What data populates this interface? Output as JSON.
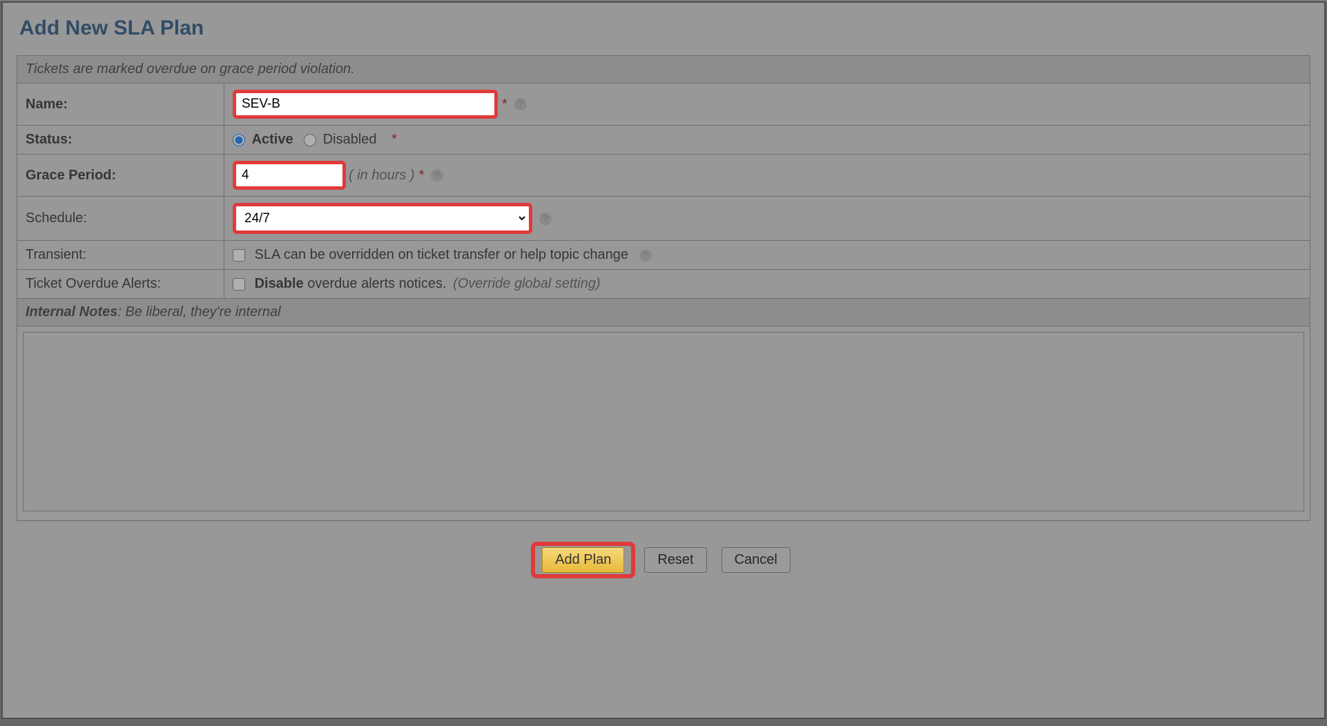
{
  "page": {
    "title": "Add New SLA Plan"
  },
  "form": {
    "header_note": "Tickets are marked overdue on grace period violation.",
    "name": {
      "label": "Name:",
      "value": "SEV-B"
    },
    "status": {
      "label": "Status:",
      "active_label": "Active",
      "disabled_label": "Disabled"
    },
    "grace_period": {
      "label": "Grace Period:",
      "value": "4",
      "hint": "( in hours )"
    },
    "schedule": {
      "label": "Schedule:",
      "value": "24/7"
    },
    "transient": {
      "label": "Transient:",
      "text": "SLA can be overridden on ticket transfer or help topic change"
    },
    "overdue_alerts": {
      "label": "Ticket Overdue Alerts:",
      "bold": "Disable",
      "text": " overdue alerts notices. ",
      "suffix": "(Override global setting)"
    },
    "notes": {
      "label": "Internal Notes",
      "suffix": ": Be liberal, they're internal",
      "value": ""
    }
  },
  "buttons": {
    "add": "Add Plan",
    "reset": "Reset",
    "cancel": "Cancel"
  }
}
